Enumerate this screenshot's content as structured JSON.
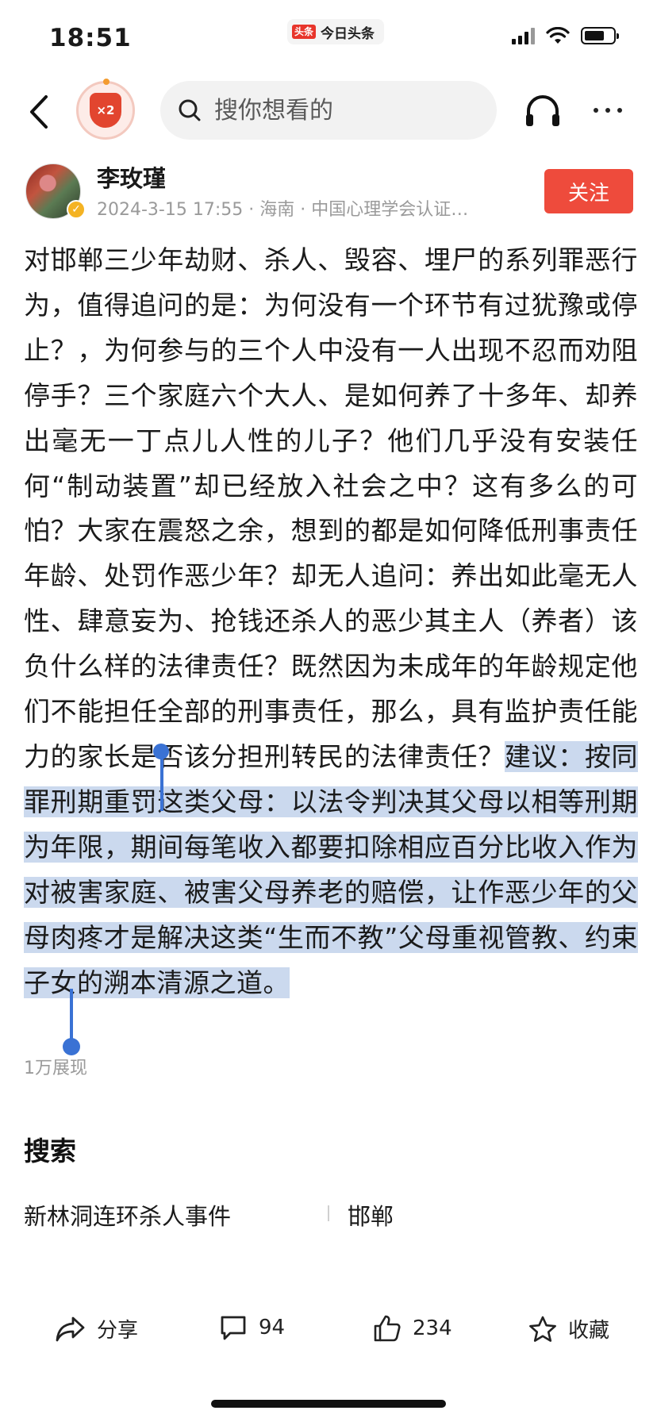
{
  "status_bar": {
    "time": "18:51",
    "app_logo": "头条",
    "app_name": "今日头条"
  },
  "nav": {
    "badge_text": "×2",
    "search_placeholder": "搜你想看的"
  },
  "author": {
    "name": "李玫瑾",
    "meta": "2024-3-15 17:55 · 海南 · 中国心理学会认证…",
    "follow_label": "关注",
    "verified_icon": "check-icon"
  },
  "article": {
    "text_plain": "对邯郸三少年劫财、杀人、毁容、埋尸的系列罪恶行为，值得追问的是：为何没有一个环节有过犹豫或停止？，为何参与的三个人中没有一人出现不忍而劝阻停手？三个家庭六个大人、是如何养了十多年、却养出毫无一丁点儿人性的儿子？他们几乎没有安装任何“制动装置”却已经放入社会之中？这有多么的可怕？大家在震怒之余，想到的都是如何降低刑事责任年龄、处罚作恶少年？却无人追问：养出如此毫无人性、肆意妄为、抢钱还杀人的恶少其主人（养者）该负什么样的法律责任？既然因为未成年的年龄规定他们不能担任全部的刑事责任，那么，具有监护责任能力的家长是否该分担刑转民的法律责任？",
    "text_selected": "建议：按同罪刑期重罚这类父母：以法令判决其父母以相等刑期为年限，期间每笔收入都要扣除相应百分比收入作为对被害家庭、被害父母养老的赔偿，让作恶少年的父母肉疼才是解决这类“生而不教”父母重视管教、约束子女的溯本清源之道。",
    "views": "1万展现"
  },
  "search_section": {
    "title": "搜索",
    "tags": [
      "新林洞连环杀人事件",
      "邯郸"
    ]
  },
  "toolbar": {
    "share_label": "分享",
    "comment_count": "94",
    "like_count": "234",
    "collect_label": "收藏"
  },
  "colors": {
    "accent": "#ee4b3c",
    "selection": "#cbd9ee",
    "handle": "#3a72d4"
  }
}
